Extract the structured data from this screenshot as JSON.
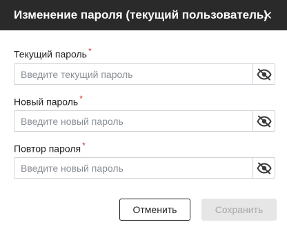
{
  "dialog": {
    "title": "Изменение пароля (текущий пользователь)",
    "close_icon": "close-icon"
  },
  "fields": {
    "current": {
      "label": "Текущий пароль",
      "required_mark": "*",
      "placeholder": "Введите текущий пароль",
      "value": "",
      "toggle_icon": "eye-off-icon"
    },
    "new": {
      "label": "Новый пароль",
      "required_mark": "*",
      "placeholder": "Введите новый пароль",
      "value": "",
      "toggle_icon": "eye-off-icon"
    },
    "repeat": {
      "label": "Повтор пароля",
      "required_mark": "*",
      "placeholder": "Введите новый пароль",
      "value": "",
      "toggle_icon": "eye-off-icon"
    }
  },
  "actions": {
    "cancel_label": "Отменить",
    "save_label": "Сохранить",
    "save_disabled": true
  },
  "colors": {
    "header_bg": "#2a2a2a",
    "required": "#d32f2f",
    "disabled_bg": "#e6e6e6",
    "disabled_text": "#a8a8a8"
  }
}
